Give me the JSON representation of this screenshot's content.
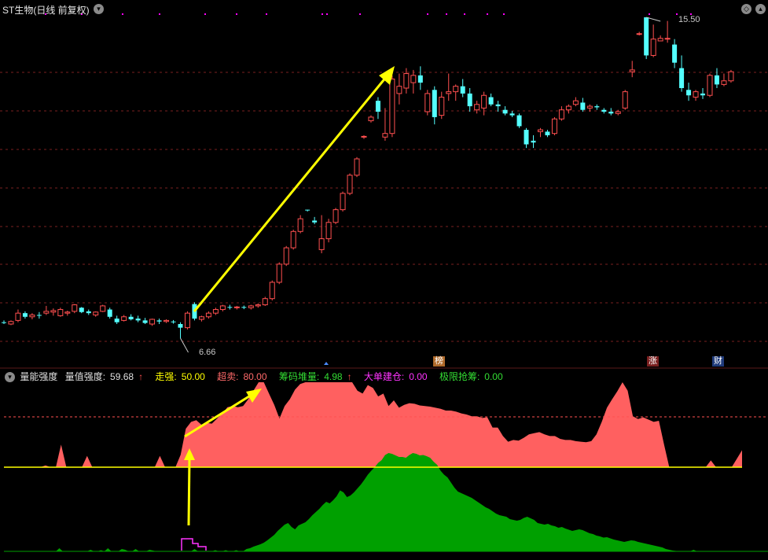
{
  "header": {
    "title": "ST生物(日线 前复权)",
    "dropdown_icon": "chevron-down-icon",
    "diamond_icon": "diamond-icon",
    "chevron_icon": "chevron-up-icon"
  },
  "price_panel": {
    "high_label": "15.50",
    "low_label": "6.66",
    "colors": {
      "up": "#ff4f4f",
      "down": "#54ffff",
      "arrow": "#ffff00",
      "grid": "#7a1f1f",
      "event_dot": "#ff00ff"
    },
    "candles": [
      [
        7.1,
        7.15,
        7.05,
        7.08
      ],
      [
        7.05,
        7.15,
        7.02,
        7.12
      ],
      [
        7.15,
        7.45,
        7.1,
        7.35
      ],
      [
        7.35,
        7.4,
        7.2,
        7.25
      ],
      [
        7.25,
        7.35,
        7.18,
        7.3
      ],
      [
        7.3,
        7.38,
        7.2,
        7.28
      ],
      [
        7.35,
        7.55,
        7.3,
        7.4
      ],
      [
        7.38,
        7.48,
        7.28,
        7.42
      ],
      [
        7.28,
        7.5,
        7.25,
        7.45
      ],
      [
        7.35,
        7.42,
        7.28,
        7.38
      ],
      [
        7.4,
        7.6,
        7.35,
        7.58
      ],
      [
        7.5,
        7.52,
        7.35,
        7.38
      ],
      [
        7.4,
        7.45,
        7.3,
        7.35
      ],
      [
        7.3,
        7.4,
        7.25,
        7.38
      ],
      [
        7.4,
        7.58,
        7.38,
        7.55
      ],
      [
        7.45,
        7.5,
        7.2,
        7.25
      ],
      [
        7.2,
        7.28,
        7.05,
        7.1
      ],
      [
        7.15,
        7.3,
        7.12,
        7.25
      ],
      [
        7.25,
        7.32,
        7.15,
        7.18
      ],
      [
        7.2,
        7.28,
        7.1,
        7.15
      ],
      [
        7.15,
        7.22,
        7.05,
        7.08
      ],
      [
        7.05,
        7.2,
        7.0,
        7.18
      ],
      [
        7.15,
        7.2,
        7.05,
        7.12
      ],
      [
        7.12,
        7.18,
        7.08,
        7.15
      ],
      [
        7.12,
        7.16,
        7.06,
        7.1
      ],
      [
        7.05,
        7.1,
        6.66,
        6.95
      ],
      [
        6.95,
        7.4,
        6.9,
        7.35
      ],
      [
        7.6,
        7.65,
        7.15,
        7.2
      ],
      [
        7.18,
        7.28,
        7.12,
        7.25
      ],
      [
        7.25,
        7.4,
        7.2,
        7.35
      ],
      [
        7.35,
        7.5,
        7.3,
        7.45
      ],
      [
        7.45,
        7.58,
        7.4,
        7.55
      ],
      [
        7.52,
        7.58,
        7.45,
        7.5
      ],
      [
        7.5,
        7.55,
        7.45,
        7.52
      ],
      [
        7.52,
        7.56,
        7.46,
        7.5
      ],
      [
        7.5,
        7.58,
        7.45,
        7.55
      ],
      [
        7.55,
        7.62,
        7.5,
        7.58
      ],
      [
        7.58,
        7.8,
        7.55,
        7.75
      ],
      [
        7.75,
        8.25,
        7.7,
        8.2
      ],
      [
        8.2,
        8.75,
        8.15,
        8.7
      ],
      [
        8.7,
        9.2,
        8.65,
        9.15
      ],
      [
        9.15,
        9.65,
        9.1,
        9.6
      ],
      [
        9.6,
        10.05,
        9.55,
        9.95
      ],
      [
        10.2,
        10.2,
        10.15,
        10.18
      ],
      [
        9.9,
        10.0,
        9.8,
        9.85
      ],
      [
        9.1,
        10.05,
        9.0,
        9.4
      ],
      [
        9.4,
        9.95,
        9.3,
        9.85
      ],
      [
        9.85,
        10.25,
        9.8,
        10.2
      ],
      [
        10.2,
        10.7,
        10.15,
        10.65
      ],
      [
        10.65,
        11.2,
        10.6,
        11.15
      ],
      [
        11.15,
        11.65,
        11.1,
        11.6
      ],
      [
        12.2,
        12.25,
        12.15,
        12.22
      ],
      [
        12.65,
        12.8,
        12.6,
        12.75
      ],
      [
        13.2,
        13.3,
        12.7,
        12.9
      ],
      [
        12.2,
        13.0,
        12.1,
        12.3
      ],
      [
        12.3,
        13.9,
        12.2,
        13.8
      ],
      [
        13.4,
        13.95,
        13.1,
        13.6
      ],
      [
        13.55,
        14.1,
        13.4,
        13.95
      ],
      [
        13.7,
        14.05,
        13.4,
        13.9
      ],
      [
        13.9,
        14.15,
        13.5,
        13.7
      ],
      [
        12.9,
        13.5,
        12.8,
        13.4
      ],
      [
        13.5,
        13.6,
        12.55,
        12.75
      ],
      [
        12.8,
        13.45,
        12.7,
        13.3
      ],
      [
        13.4,
        13.95,
        13.2,
        13.45
      ],
      [
        13.45,
        13.65,
        13.2,
        13.6
      ],
      [
        13.6,
        13.8,
        13.3,
        13.4
      ],
      [
        13.4,
        13.55,
        12.9,
        13.05
      ],
      [
        12.95,
        13.2,
        12.85,
        13.1
      ],
      [
        13.0,
        13.45,
        12.8,
        13.35
      ],
      [
        13.3,
        13.4,
        13.05,
        13.1
      ],
      [
        13.1,
        13.2,
        12.9,
        13.05
      ],
      [
        12.95,
        13.05,
        12.8,
        12.85
      ],
      [
        12.85,
        12.92,
        12.75,
        12.8
      ],
      [
        12.8,
        12.85,
        12.45,
        12.5
      ],
      [
        12.4,
        12.45,
        11.9,
        12.0
      ],
      [
        12.1,
        12.25,
        11.9,
        12.05
      ],
      [
        12.35,
        12.45,
        12.2,
        12.4
      ],
      [
        12.35,
        12.4,
        12.2,
        12.25
      ],
      [
        12.3,
        12.75,
        12.25,
        12.7
      ],
      [
        12.7,
        13.05,
        12.65,
        12.95
      ],
      [
        12.95,
        13.1,
        12.85,
        13.05
      ],
      [
        13.1,
        13.3,
        13.05,
        13.2
      ],
      [
        13.15,
        13.28,
        12.9,
        12.95
      ],
      [
        13.0,
        13.1,
        12.9,
        13.05
      ],
      [
        13.05,
        13.1,
        12.95,
        13.02
      ],
      [
        12.95,
        13.0,
        12.85,
        12.9
      ],
      [
        12.9,
        13.0,
        12.8,
        12.85
      ],
      [
        12.85,
        12.95,
        12.8,
        12.9
      ],
      [
        13.0,
        13.5,
        12.95,
        13.45
      ],
      [
        14.0,
        14.3,
        13.85,
        14.05
      ],
      [
        15.05,
        15.1,
        15.0,
        15.05
      ],
      [
        15.5,
        15.5,
        14.35,
        14.45
      ],
      [
        14.45,
        15.3,
        14.4,
        14.9
      ],
      [
        14.85,
        15.0,
        14.85,
        14.92
      ],
      [
        14.9,
        15.4,
        14.8,
        14.92
      ],
      [
        14.75,
        14.9,
        14.1,
        14.25
      ],
      [
        14.1,
        14.45,
        13.45,
        13.55
      ],
      [
        13.5,
        13.7,
        13.2,
        13.35
      ],
      [
        13.3,
        13.5,
        13.2,
        13.45
      ],
      [
        13.4,
        13.55,
        13.25,
        13.35
      ],
      [
        13.35,
        13.95,
        13.3,
        13.9
      ],
      [
        13.9,
        14.1,
        13.55,
        13.65
      ],
      [
        13.65,
        13.95,
        13.6,
        13.75
      ],
      [
        13.75,
        14.05,
        13.7,
        14.0
      ]
    ]
  },
  "event_tags": [
    {
      "text": "榜",
      "bg": "#b06a2a",
      "color": "#ffffff"
    },
    {
      "text": "涨",
      "bg": "#7a1f1f",
      "color": "#ffffff"
    },
    {
      "text": "财",
      "bg": "#1f3a7a",
      "color": "#ffffff"
    }
  ],
  "indicator": {
    "name": "量能强度",
    "items": [
      {
        "label": "量值强度:",
        "value": "59.68",
        "suffix": "↑",
        "label_color": "#e0e0e0",
        "value_color": "#e0e0e0",
        "suffix_color": "#ff4f4f"
      },
      {
        "label": "走强:",
        "value": "50.00",
        "suffix": "",
        "label_color": "#ffff00",
        "value_color": "#ffff00",
        "suffix_color": ""
      },
      {
        "label": "超卖:",
        "value": "80.00",
        "suffix": "",
        "label_color": "#ff6a6a",
        "value_color": "#ff6a6a",
        "suffix_color": ""
      },
      {
        "label": "筹码堆量:",
        "value": "4.98",
        "suffix": "↑",
        "label_color": "#33dd33",
        "value_color": "#33dd33",
        "suffix_color": "#ff4f4f"
      },
      {
        "label": "大单建仓:",
        "value": "0.00",
        "suffix": "",
        "label_color": "#ff33ff",
        "value_color": "#ff33ff",
        "suffix_color": ""
      },
      {
        "label": "极限抢筹:",
        "value": "0.00",
        "suffix": "",
        "label_color": "#33dd33",
        "value_color": "#33dd33",
        "suffix_color": ""
      }
    ],
    "strength_series": [
      0,
      0,
      0,
      0,
      0,
      0,
      0,
      0,
      3,
      0,
      0,
      40,
      0,
      0,
      0,
      0,
      20,
      0,
      0,
      0,
      0,
      0,
      0,
      0,
      0,
      0,
      0,
      0,
      0,
      0,
      20,
      0,
      0,
      0,
      22,
      68,
      80,
      83,
      75,
      78,
      77,
      86,
      94,
      106,
      108,
      106,
      108,
      120,
      135,
      150,
      150,
      130,
      110,
      86,
      108,
      120,
      137,
      147,
      150,
      150,
      150,
      150,
      150,
      150,
      150,
      150,
      150,
      150,
      135,
      130,
      145,
      140,
      125,
      130,
      108,
      118,
      105,
      110,
      113,
      112,
      109,
      108,
      107,
      105,
      103,
      100,
      100,
      98,
      95,
      93,
      90,
      90,
      87,
      88,
      70,
      70,
      55,
      45,
      48,
      47,
      52,
      58,
      60,
      62,
      58,
      55,
      55,
      50,
      48,
      48,
      46,
      45,
      44,
      46,
      58,
      80,
      105,
      120,
      134,
      150,
      135,
      90,
      85,
      88,
      84,
      80,
      82,
      40,
      0,
      0,
      0,
      0,
      0,
      0,
      0,
      0,
      12,
      0,
      0,
      0,
      0,
      15,
      30
    ],
    "chip_series": [
      0,
      0,
      0,
      0,
      0,
      0,
      0,
      0,
      0,
      0,
      0,
      0,
      0,
      0,
      0,
      0,
      8,
      0,
      0,
      0,
      0,
      0,
      0,
      0,
      0,
      4,
      0,
      0,
      3,
      0,
      8,
      0,
      0,
      0,
      6,
      4,
      0,
      0,
      6,
      0,
      0,
      0,
      4,
      2,
      0,
      0,
      0,
      0,
      0,
      0,
      0,
      0,
      0,
      0,
      0,
      6,
      0,
      0,
      0,
      0,
      0,
      3,
      0,
      0,
      3,
      0,
      0,
      3,
      0,
      0,
      6,
      8,
      12,
      15,
      18,
      22,
      28,
      35,
      42,
      52,
      60,
      68,
      72,
      62,
      56,
      66,
      70,
      74,
      82,
      92,
      100,
      108,
      118,
      126,
      122,
      130,
      140,
      155,
      150,
      138,
      142,
      150,
      160,
      170,
      182,
      195,
      205,
      214,
      225,
      232,
      245,
      250,
      248,
      244,
      240,
      240,
      238,
      245,
      250,
      248,
      244,
      245,
      242,
      238,
      228,
      220,
      205,
      195,
      188,
      175,
      162,
      152,
      148,
      144,
      140,
      136,
      130,
      124,
      118,
      112,
      108,
      102,
      96,
      92,
      90,
      88,
      82,
      80,
      78,
      80,
      85,
      88,
      84,
      80,
      72,
      70,
      68,
      70,
      66,
      64,
      60,
      62,
      58,
      55,
      52,
      54,
      56,
      54,
      50,
      46,
      44,
      40,
      38,
      35,
      36,
      33,
      30,
      28,
      26,
      24,
      26,
      28,
      27,
      24,
      22,
      20,
      18,
      16,
      14,
      12,
      10,
      6,
      4,
      2,
      1,
      0,
      0,
      0,
      0,
      4,
      0,
      0,
      0,
      0,
      0,
      0,
      0,
      0,
      0,
      0,
      0,
      0,
      0,
      0
    ],
    "colors": {
      "strength": "#ff6060",
      "chip": "#00a000",
      "baseline": "#ffff00",
      "threshold": "#ff4f4f",
      "big": "#ff33ff"
    }
  }
}
